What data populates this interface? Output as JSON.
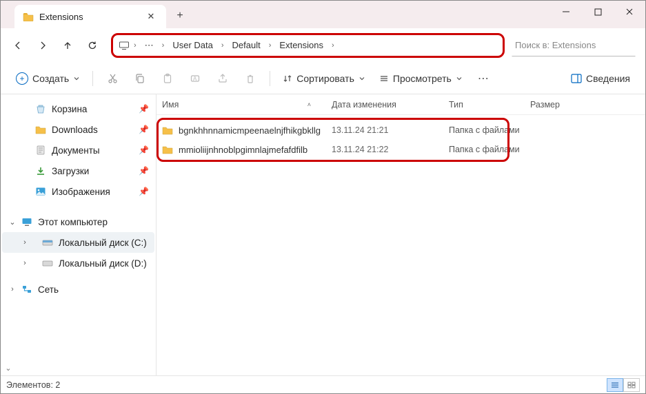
{
  "tab": {
    "title": "Extensions"
  },
  "breadcrumb": {
    "segments": [
      "User Data",
      "Default",
      "Extensions"
    ]
  },
  "search": {
    "placeholder": "Поиск в: Extensions"
  },
  "toolbar": {
    "create": "Создать",
    "sort": "Сортировать",
    "view": "Просмотреть",
    "details": "Сведения"
  },
  "sidebar": {
    "quick": [
      {
        "label": "Корзина",
        "icon": "recycle"
      },
      {
        "label": "Downloads",
        "icon": "folder"
      },
      {
        "label": "Документы",
        "icon": "doc"
      },
      {
        "label": "Загрузки",
        "icon": "download"
      },
      {
        "label": "Изображения",
        "icon": "image"
      }
    ],
    "thispc": "Этот компьютер",
    "drives": [
      {
        "label": "Локальный диск (C:)"
      },
      {
        "label": "Локальный диск (D:)"
      }
    ],
    "network": "Сеть"
  },
  "columns": {
    "name": "Имя",
    "date": "Дата изменения",
    "type": "Тип",
    "size": "Размер"
  },
  "rows": [
    {
      "name": "bgnkhhnnamicmpeenaelnjfhikgbkllg",
      "date": "13.11.24 21:21",
      "type": "Папка с файлами"
    },
    {
      "name": "mmioliijnhnoblpgimnlajmefafdfilb",
      "date": "13.11.24 21:22",
      "type": "Папка с файлами"
    }
  ],
  "status": {
    "text": "Элементов: 2"
  }
}
